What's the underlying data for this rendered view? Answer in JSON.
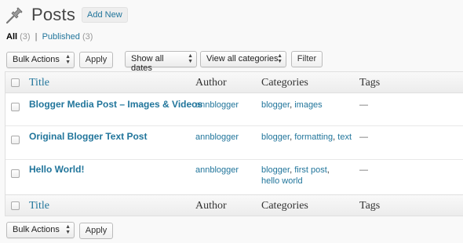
{
  "header": {
    "title": "Posts",
    "add_new_label": "Add New"
  },
  "filters": {
    "all_label": "All",
    "all_count": "(3)",
    "separator": "|",
    "published_label": "Published",
    "published_count": "(3)"
  },
  "top_toolbar": {
    "bulk_actions": "Bulk Actions",
    "apply_label": "Apply",
    "dates_select": "Show all dates",
    "categories_select": "View all categories",
    "filter_label": "Filter"
  },
  "columns": {
    "title": "Title",
    "author": "Author",
    "categories": "Categories",
    "tags": "Tags"
  },
  "rows": [
    {
      "title": "Blogger Media Post – Images & Videos",
      "author": "annblogger",
      "categories": [
        "blogger",
        "images"
      ],
      "tags": "—"
    },
    {
      "title": "Original Blogger Text Post",
      "author": "annblogger",
      "categories": [
        "blogger",
        "formatting",
        "text"
      ],
      "tags": "—"
    },
    {
      "title": "Hello World!",
      "author": "annblogger",
      "categories": [
        "blogger",
        "first post",
        "hello world"
      ],
      "tags": "—"
    }
  ],
  "bottom_toolbar": {
    "bulk_actions": "Bulk Actions",
    "apply_label": "Apply"
  },
  "icons": {
    "posts": "pushpin-icon",
    "select_arrows": "updown-arrows-icon"
  },
  "colors": {
    "link": "#21759b",
    "title_text": "#464646",
    "background": "#f9f9f9"
  }
}
